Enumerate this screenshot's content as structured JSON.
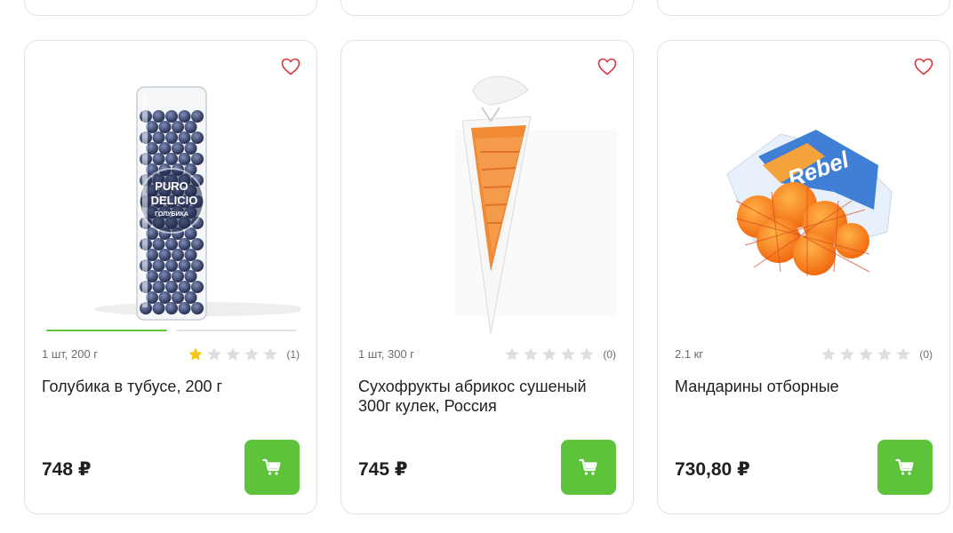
{
  "products": [
    {
      "weight": "1 шт, 200 г",
      "title": "Голубика в тубусе, 200 г",
      "price": "748 ₽",
      "rating_count": "(1)",
      "rating": 1,
      "image_text_1": "PURO",
      "image_text_2": "DELICIO",
      "image_text_3": "ГОЛУБИКА"
    },
    {
      "weight": "1 шт, 300 г",
      "title": "Сухофрукты абрикос сушеный 300г кулек, Россия",
      "price": "745 ₽",
      "rating_count": "(0)",
      "rating": 0
    },
    {
      "weight": "2.1 кг",
      "title": "Мандарины отборные",
      "price": "730,80 ₽",
      "rating_count": "(0)",
      "rating": 0,
      "image_text": "Rebel"
    }
  ],
  "colors": {
    "accent_green": "#5cc33b",
    "favorite_red": "#d9363e",
    "star_gold": "#f5c518",
    "star_empty": "#d9d9d9"
  },
  "icons": {
    "favorite": "heart-outline-icon",
    "cart": "cart-icon",
    "star": "star-icon"
  }
}
